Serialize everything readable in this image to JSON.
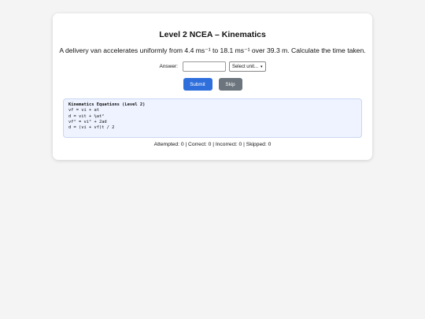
{
  "quiz": {
    "title": "Level 2 NCEA – Kinematics",
    "question": "A delivery van accelerates uniformly from 4.4 ms⁻¹ to 18.1 ms⁻¹ over 39.3 m. Calculate the time taken.",
    "answer_label": "Answer:",
    "answer_value": "",
    "unit_select": "Select unit...",
    "submit_label": "Submit",
    "skip_label": "Skip"
  },
  "equations": {
    "title": "Kinematics Equations (Level 2)",
    "lines": [
      "vf = vi + at",
      "d = vit + ½at²",
      "vf² = vi² + 2ad",
      "d = (vi + vf)t / 2"
    ]
  },
  "stats": {
    "text": "Attempted: 0 | Correct: 0 | Incorrect: 0 | Skipped: 0"
  }
}
